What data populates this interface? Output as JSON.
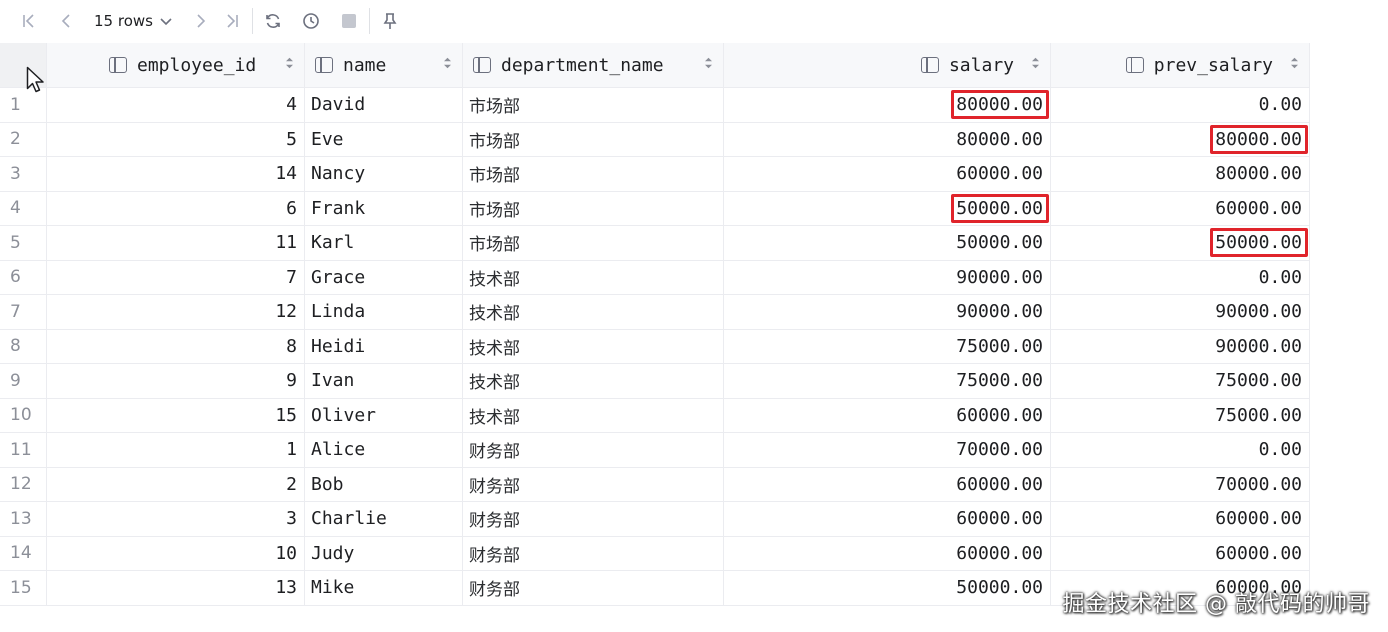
{
  "toolbar": {
    "rows_label": "15 rows",
    "icons": [
      "first-page-icon",
      "prev-page-icon",
      "chevron-down-icon",
      "next-page-icon",
      "last-page-icon",
      "refresh-icon",
      "history-icon",
      "stop-icon",
      "pin-icon"
    ]
  },
  "columns": [
    {
      "label": "employee_id"
    },
    {
      "label": "name"
    },
    {
      "label": "department_name"
    },
    {
      "label": "salary"
    },
    {
      "label": "prev_salary"
    }
  ],
  "rows": [
    {
      "n": "1",
      "employee_id": "4",
      "name": "David",
      "department_name": "市场部",
      "salary": "80000.00",
      "prev_salary": "0.00"
    },
    {
      "n": "2",
      "employee_id": "5",
      "name": "Eve",
      "department_name": "市场部",
      "salary": "80000.00",
      "prev_salary": "80000.00"
    },
    {
      "n": "3",
      "employee_id": "14",
      "name": "Nancy",
      "department_name": "市场部",
      "salary": "60000.00",
      "prev_salary": "80000.00"
    },
    {
      "n": "4",
      "employee_id": "6",
      "name": "Frank",
      "department_name": "市场部",
      "salary": "50000.00",
      "prev_salary": "60000.00"
    },
    {
      "n": "5",
      "employee_id": "11",
      "name": "Karl",
      "department_name": "市场部",
      "salary": "50000.00",
      "prev_salary": "50000.00"
    },
    {
      "n": "6",
      "employee_id": "7",
      "name": "Grace",
      "department_name": "技术部",
      "salary": "90000.00",
      "prev_salary": "0.00"
    },
    {
      "n": "7",
      "employee_id": "12",
      "name": "Linda",
      "department_name": "技术部",
      "salary": "90000.00",
      "prev_salary": "90000.00"
    },
    {
      "n": "8",
      "employee_id": "8",
      "name": "Heidi",
      "department_name": "技术部",
      "salary": "75000.00",
      "prev_salary": "90000.00"
    },
    {
      "n": "9",
      "employee_id": "9",
      "name": "Ivan",
      "department_name": "技术部",
      "salary": "75000.00",
      "prev_salary": "75000.00"
    },
    {
      "n": "10",
      "employee_id": "15",
      "name": "Oliver",
      "department_name": "技术部",
      "salary": "60000.00",
      "prev_salary": "75000.00"
    },
    {
      "n": "11",
      "employee_id": "1",
      "name": "Alice",
      "department_name": "财务部",
      "salary": "70000.00",
      "prev_salary": "0.00"
    },
    {
      "n": "12",
      "employee_id": "2",
      "name": "Bob",
      "department_name": "财务部",
      "salary": "60000.00",
      "prev_salary": "70000.00"
    },
    {
      "n": "13",
      "employee_id": "3",
      "name": "Charlie",
      "department_name": "财务部",
      "salary": "60000.00",
      "prev_salary": "60000.00"
    },
    {
      "n": "14",
      "employee_id": "10",
      "name": "Judy",
      "department_name": "财务部",
      "salary": "60000.00",
      "prev_salary": "60000.00"
    },
    {
      "n": "15",
      "employee_id": "13",
      "name": "Mike",
      "department_name": "财务部",
      "salary": "50000.00",
      "prev_salary": "60000.00"
    }
  ],
  "highlights": [
    {
      "row": 0,
      "column": "salary"
    },
    {
      "row": 1,
      "column": "prev_salary"
    },
    {
      "row": 3,
      "column": "salary"
    },
    {
      "row": 4,
      "column": "prev_salary"
    }
  ],
  "highlight_color": "#e0242b",
  "watermark": "掘金技术社区 @ 敲代码的帅哥"
}
